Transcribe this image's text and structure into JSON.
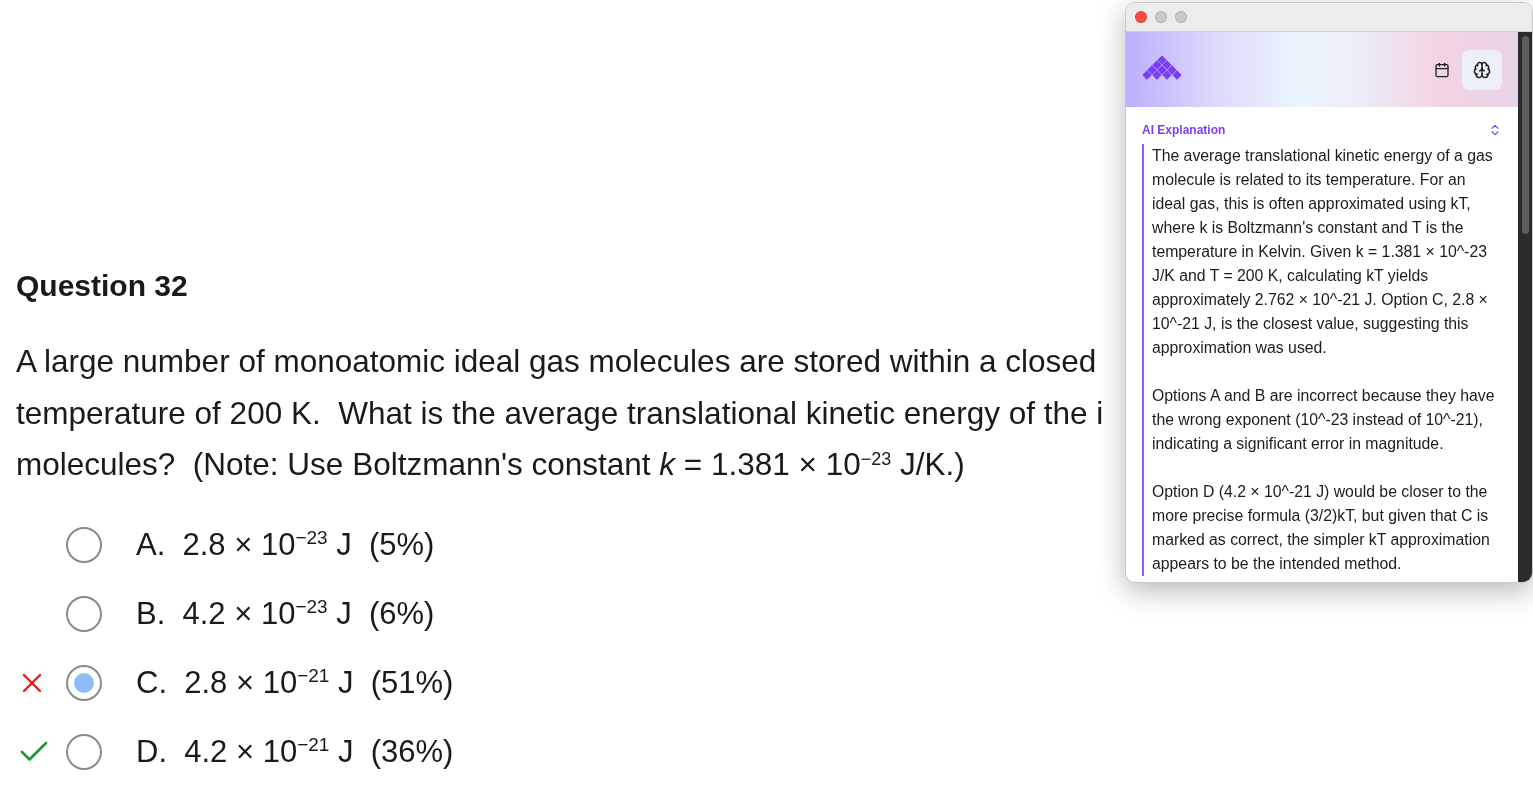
{
  "question": {
    "title": "Question 32",
    "lines": [
      "A large number of monoatomic ideal gas molecules are stored within a closed",
      "temperature of 200 K.  What is the average translational kinetic energy of the i",
      "molecules?  (Note: Use Boltzmann's constant *k* = 1.381 × 10$^{−23}$ J/K.)"
    ]
  },
  "options": [
    {
      "label": "A.  2.8 × 10$^{−23}$ J  (5%)",
      "selected": false,
      "wrong": false,
      "correct": false
    },
    {
      "label": "B.  4.2 × 10$^{−23}$ J  (6%)",
      "selected": false,
      "wrong": false,
      "correct": false
    },
    {
      "label": "C.  2.8 × 10$^{−21}$ J  (51%)",
      "selected": true,
      "wrong": true,
      "correct": false
    },
    {
      "label": "D.  4.2 × 10$^{−21}$ J  (36%)",
      "selected": false,
      "wrong": false,
      "correct": true
    }
  ],
  "panel": {
    "section_title": "AI Explanation",
    "paragraphs": [
      "The average translational kinetic energy of a gas molecule is related to its temperature. For an ideal gas, this is often approximated using kT, where k is Boltzmann's constant and T is the temperature in Kelvin. Given k = 1.381 × 10^-23 J/K and T = 200 K, calculating kT yields approximately 2.762 × 10^-21 J. Option C, 2.8 × 10^-21 J, is the closest value, suggesting this approximation was used.",
      "Options A and B are incorrect because they have the wrong exponent (10^-23 instead of 10^-21), indicating a significant error in magnitude.",
      "Option D (4.2 × 10^-21 J) would be closer to the more precise formula (3/2)kT, but given that C is marked as correct, the simpler kT approximation appears to be the intended method."
    ]
  }
}
